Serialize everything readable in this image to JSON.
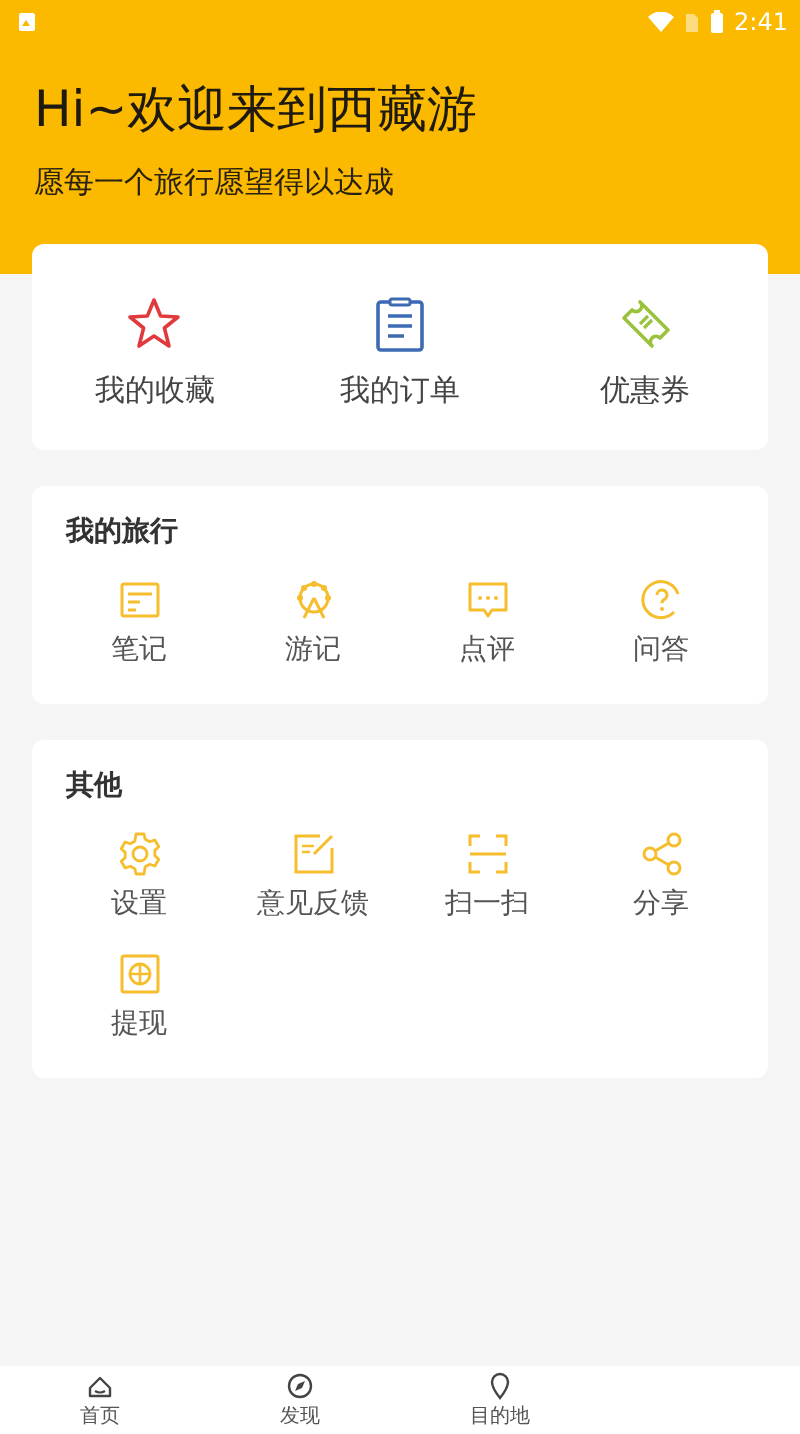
{
  "status_bar": {
    "time": "2:41"
  },
  "header": {
    "title": "Hi~欢迎来到西藏游",
    "subtitle": "愿每一个旅行愿望得以达成"
  },
  "quick_links": [
    {
      "label": "我的收藏"
    },
    {
      "label": "我的订单"
    },
    {
      "label": "优惠券"
    }
  ],
  "sections": [
    {
      "title": "我的旅行",
      "items": [
        {
          "label": "笔记"
        },
        {
          "label": "游记"
        },
        {
          "label": "点评"
        },
        {
          "label": "问答"
        }
      ]
    },
    {
      "title": "其他",
      "items": [
        {
          "label": "设置"
        },
        {
          "label": "意见反馈"
        },
        {
          "label": "扫一扫"
        },
        {
          "label": "分享"
        },
        {
          "label": "提现"
        }
      ]
    }
  ],
  "bottom_nav": [
    {
      "label": "首页",
      "selected": false
    },
    {
      "label": "发现",
      "selected": false
    },
    {
      "label": "目的地",
      "selected": false
    }
  ]
}
